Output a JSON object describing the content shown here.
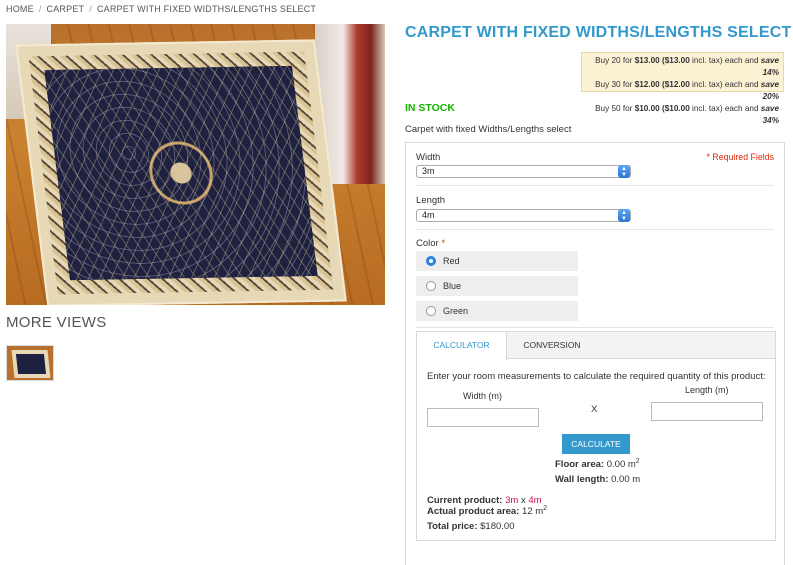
{
  "breadcrumb": {
    "items": [
      "HOME",
      "CARPET",
      "CARPET WITH FIXED WIDTHS/LENGTHS SELECT"
    ],
    "separator": "/"
  },
  "gallery": {
    "more_views_label": "MORE VIEWS"
  },
  "product": {
    "title": "CARPET WITH FIXED WIDTHS/LENGTHS SELECT",
    "stock_status": "IN STOCK",
    "stock_color": "#11b400",
    "description": "Carpet with fixed Widths/Lengths select"
  },
  "tier_prices": [
    {
      "prefix": "Buy 20 for ",
      "price": "$13.00 ($13.00",
      "middle": " incl. tax) each and ",
      "save": "save 14%"
    },
    {
      "prefix": "Buy 30 for ",
      "price": "$12.00 ($12.00",
      "middle": " incl. tax) each and ",
      "save": "save 20%"
    },
    {
      "prefix": "Buy 50 for ",
      "price": "$10.00 ($10.00",
      "middle": " incl. tax) each and ",
      "save": "save 34%"
    }
  ],
  "options": {
    "required_fields_label": "* Required Fields",
    "width_label": "Width",
    "width_value": "3m",
    "length_label": "Length",
    "length_value": "4m",
    "color_label": "Color",
    "required_star": "*",
    "colors": [
      "Red",
      "Blue",
      "Green"
    ],
    "selected_color": "Red"
  },
  "calculator": {
    "tabs": [
      "CALCULATOR",
      "CONVERSION"
    ],
    "active_tab": "CALCULATOR",
    "intro": "Enter your room measurements to calculate the required quantity of this product:",
    "width_label": "Width (m)",
    "length_label": "Length (m)",
    "times": "X",
    "button_label": "CALCULATE",
    "floor_area_label": "Floor area:",
    "floor_area_value": "0.00 m",
    "wall_length_label": "Wall length:",
    "wall_length_value": "0.00 m",
    "current_product_label": "Current product:",
    "current_product_width": "3m",
    "current_product_x": " x ",
    "current_product_length": "4m",
    "actual_area_label": "Actual product area:",
    "actual_area_value": "12 m",
    "total_price_label": "Total price:",
    "total_price_value": "$180.00",
    "superscript": "2"
  },
  "colors": {
    "accent": "#3399cc",
    "required": "#df280a",
    "highlight": "#cc1155"
  }
}
